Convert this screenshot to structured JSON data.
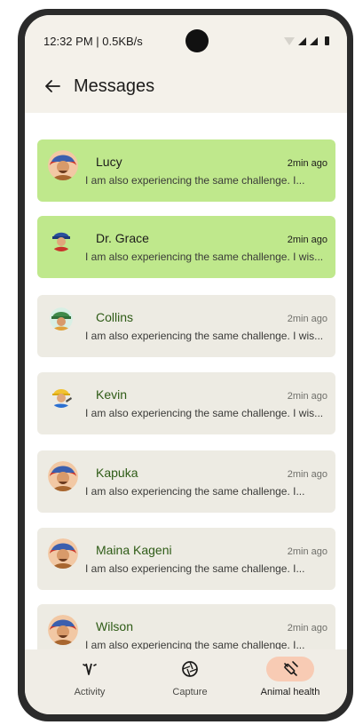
{
  "status_bar": {
    "text": "12:32 PM | 0.5KB/s"
  },
  "app_bar": {
    "title": "Messages"
  },
  "messages": [
    {
      "name": "Lucy",
      "time": "2min ago",
      "preview": "I am also experiencing the same challenge. I...",
      "unread": true,
      "avatar": "woman-red-headscarf"
    },
    {
      "name": "Dr. Grace",
      "time": "2min ago",
      "preview": "I am also experiencing the same challenge. I wis...",
      "unread": true,
      "avatar": "man-blue-cap"
    },
    {
      "name": "Collins",
      "time": "2min ago",
      "preview": "I am also experiencing the same challenge. I wis...",
      "unread": false,
      "avatar": "person-green-hat"
    },
    {
      "name": "Kevin",
      "time": "2min ago",
      "preview": "I am also experiencing the same challenge. I wis...",
      "unread": false,
      "avatar": "man-yellow-helmet"
    },
    {
      "name": "Kapuka",
      "time": "2min ago",
      "preview": "I am also experiencing the same challenge. I...",
      "unread": false,
      "avatar": "woman-red-headscarf"
    },
    {
      "name": "Maina Kageni",
      "time": "2min ago",
      "preview": "I am also experiencing the same challenge. I...",
      "unread": false,
      "avatar": "woman-red-headscarf"
    },
    {
      "name": "Wilson",
      "time": "2min ago",
      "preview": "I am also experiencing the same challenge. I...",
      "unread": false,
      "avatar": "woman-red-headscarf"
    }
  ],
  "bottom_nav": [
    {
      "label": "Activity",
      "icon": "activity-icon",
      "active": false
    },
    {
      "label": "Capture",
      "icon": "aperture-icon",
      "active": false
    },
    {
      "label": "Animal health",
      "icon": "syringe-icon",
      "active": true
    }
  ],
  "colors": {
    "unread_card": "#bfe88c",
    "read_card": "#edebe3",
    "active_nav": "#f8cbb4",
    "name_green": "#2e5b16"
  }
}
